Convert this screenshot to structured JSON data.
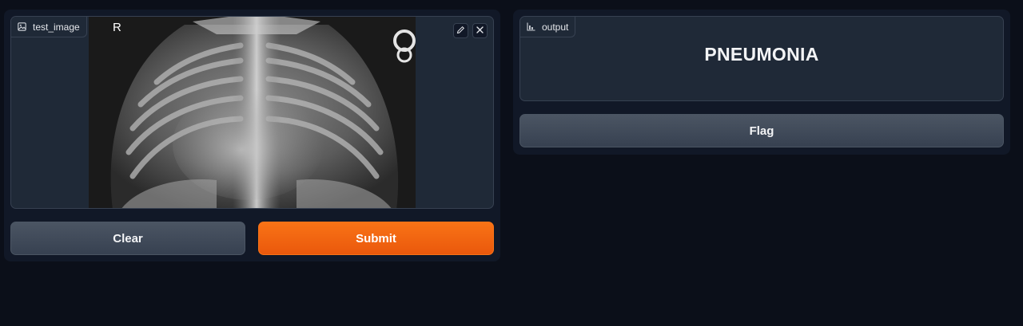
{
  "input": {
    "label": "test_image",
    "image_marker": "R",
    "icons": {
      "label": "image-icon",
      "edit": "pencil-icon",
      "clear": "close-icon"
    }
  },
  "actions": {
    "clear_label": "Clear",
    "submit_label": "Submit",
    "flag_label": "Flag"
  },
  "output": {
    "label": "output",
    "icon": "bar-chart-icon",
    "prediction": "PNEUMONIA"
  },
  "colors": {
    "background": "#0b0f19",
    "panel": "#111827",
    "block": "#1f2937",
    "border": "#374151",
    "primary": "#f97316",
    "secondary": "#4b5563"
  }
}
